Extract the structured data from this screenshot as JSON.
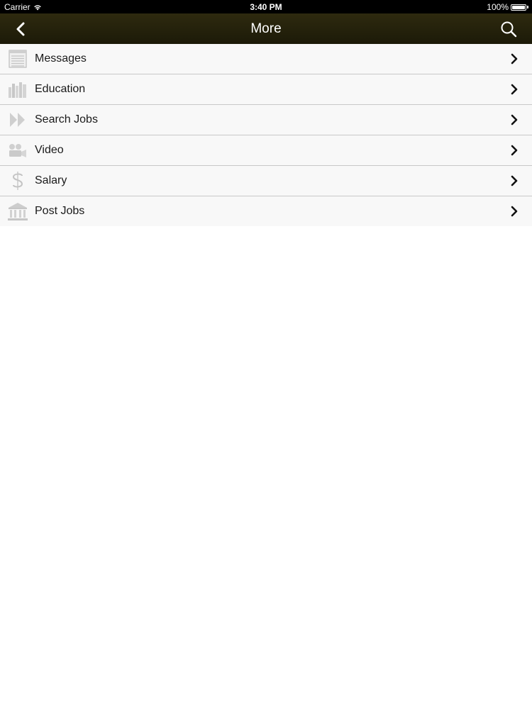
{
  "status_bar": {
    "carrier": "Carrier",
    "time": "3:40 PM",
    "battery": "100%"
  },
  "nav": {
    "title": "More",
    "back_icon": "chevron-left-icon",
    "search_icon": "search-icon"
  },
  "menu": {
    "items": [
      {
        "label": "Messages",
        "icon": "list-icon"
      },
      {
        "label": "Education",
        "icon": "books-icon"
      },
      {
        "label": "Search Jobs",
        "icon": "fast-forward-icon"
      },
      {
        "label": "Video",
        "icon": "video-camera-icon"
      },
      {
        "label": "Salary",
        "icon": "dollar-icon"
      },
      {
        "label": "Post Jobs",
        "icon": "building-icon"
      }
    ]
  },
  "colors": {
    "nav_background": "#24210c",
    "row_background": "#f8f8f8",
    "icon_gray": "#c4c4c4"
  }
}
